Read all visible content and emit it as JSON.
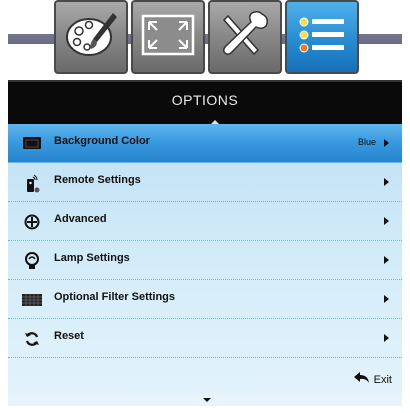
{
  "tabs": [
    {
      "name": "palette-icon",
      "active": false
    },
    {
      "name": "fullscreen-icon",
      "active": false
    },
    {
      "name": "tools-icon",
      "active": false
    },
    {
      "name": "list-icon",
      "active": true
    }
  ],
  "header": {
    "title": "OPTIONS"
  },
  "menu": {
    "items": [
      {
        "label": "Background Color",
        "value": "Blue",
        "icon": "monitor-icon",
        "selected": true
      },
      {
        "label": "Remote Settings",
        "value": "",
        "icon": "remote-icon",
        "selected": false
      },
      {
        "label": "Advanced",
        "value": "",
        "icon": "target-icon",
        "selected": false
      },
      {
        "label": "Lamp Settings",
        "value": "",
        "icon": "lamp-icon",
        "selected": false
      },
      {
        "label": "Optional Filter Settings",
        "value": "",
        "icon": "filter-icon",
        "selected": false
      },
      {
        "label": "Reset",
        "value": "",
        "icon": "reset-icon",
        "selected": false
      }
    ],
    "exit_label": "Exit"
  },
  "colors": {
    "selected_row": "#3a9be0",
    "active_tab": "#2a8fd4",
    "header_bg": "#0a0a0a",
    "menu_bg": "#d4ecf9"
  }
}
